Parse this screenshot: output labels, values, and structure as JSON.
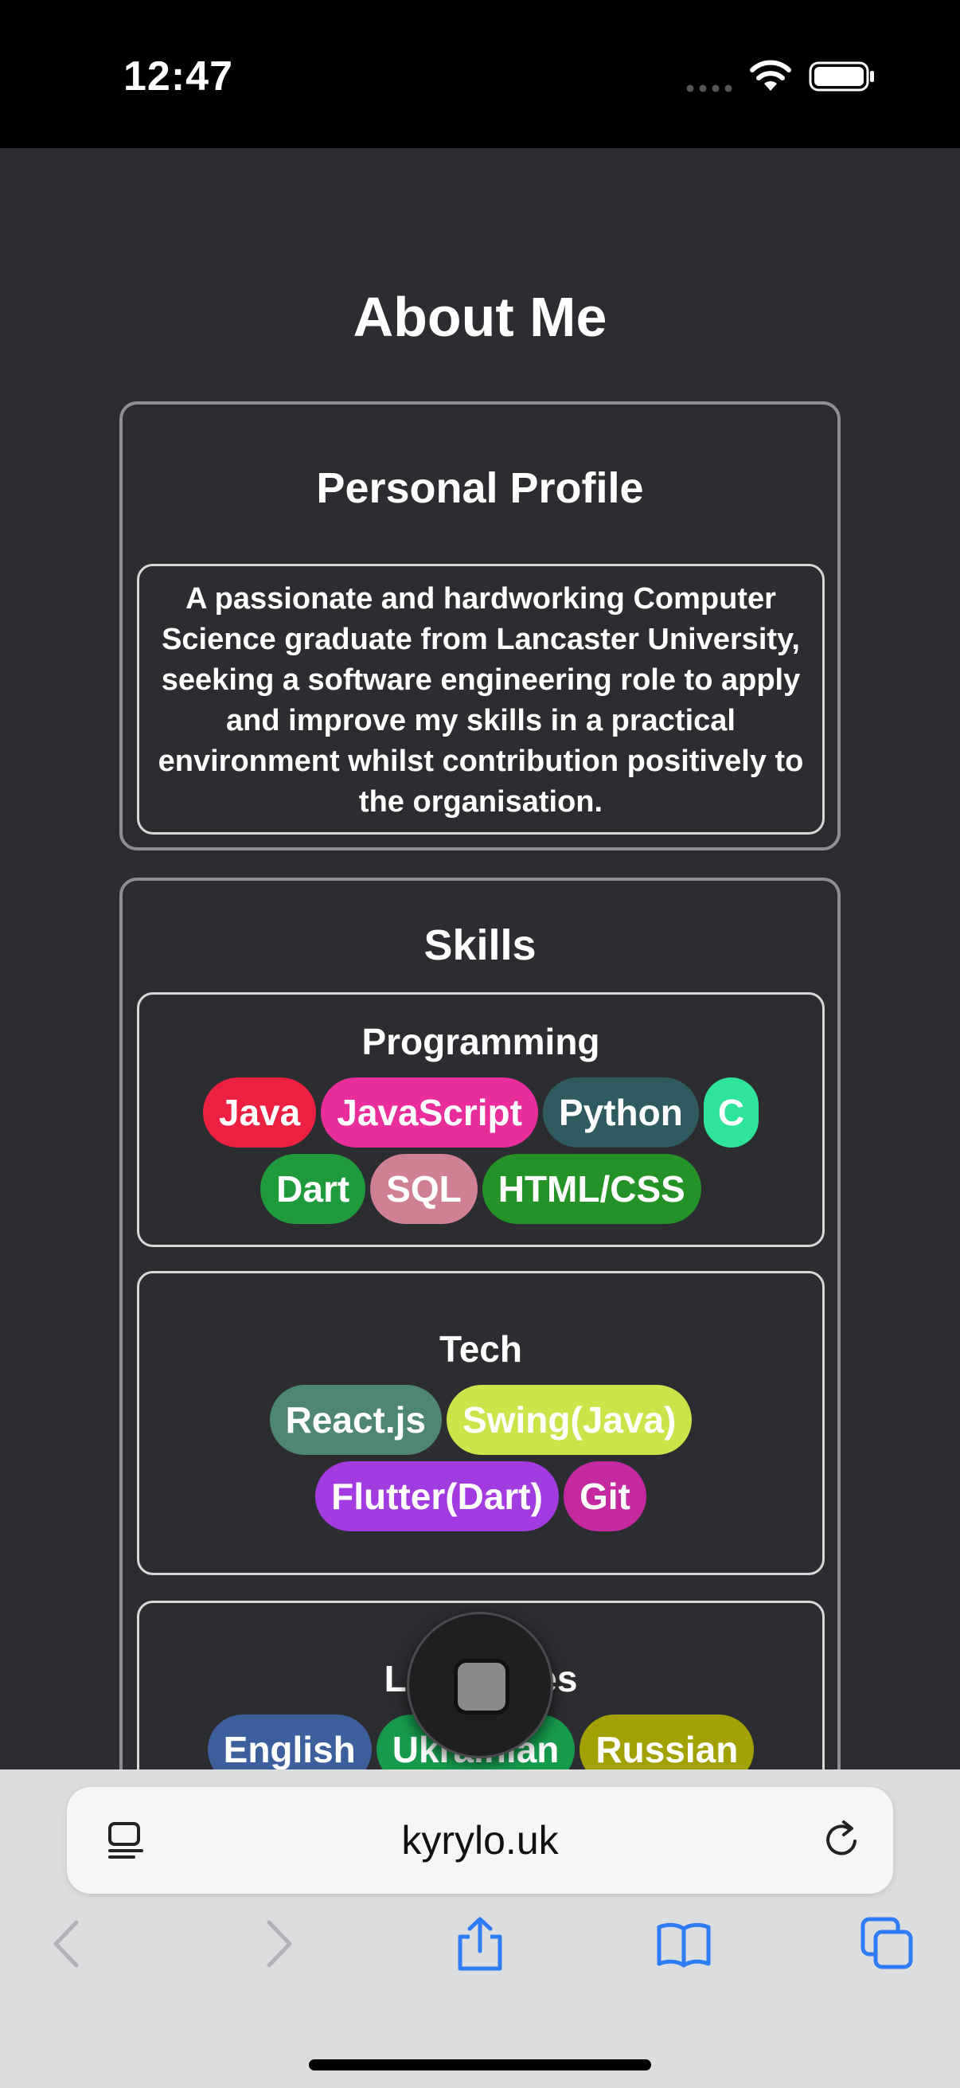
{
  "status_bar": {
    "time": "12:47"
  },
  "page": {
    "title": "About Me",
    "profile": {
      "title": "Personal Profile",
      "text": "A passionate and hardworking Computer Science graduate from Lancaster University, seeking a software engineering role to apply and improve my skills in a practical environment whilst contribution positively to the organisation."
    },
    "skills": {
      "title": "Skills",
      "programming": {
        "title": "Programming",
        "tags": [
          {
            "label": "Java",
            "color": "#ec2040"
          },
          {
            "label": "JavaScript",
            "color": "#e92e9c"
          },
          {
            "label": "Python",
            "color": "#2f5b60"
          },
          {
            "label": "C",
            "color": "#2ee39a"
          },
          {
            "label": "Dart",
            "color": "#1f9a3c"
          },
          {
            "label": "SQL",
            "color": "#cf8193"
          },
          {
            "label": "HTML/CSS",
            "color": "#259228"
          }
        ]
      },
      "tech": {
        "title": "Tech",
        "tags": [
          {
            "label": "React.js",
            "color": "#4e8672"
          },
          {
            "label": "Swing(Java)",
            "color": "#cbe44a"
          },
          {
            "label": "Flutter(Dart)",
            "color": "#a23be0"
          },
          {
            "label": "Git",
            "color": "#c429a0"
          }
        ]
      },
      "languages": {
        "title": "Languages",
        "tags": [
          {
            "label": "English",
            "color": "#3d5f9c"
          },
          {
            "label": "Ukrainian",
            "color": "#169a4c"
          },
          {
            "label": "Russian",
            "color": "#a3a102"
          }
        ]
      }
    }
  },
  "browser": {
    "url": "kyrylo.uk",
    "icons": [
      "reader-icon",
      "reload-icon",
      "back-icon",
      "forward-icon",
      "share-icon",
      "bookmarks-icon",
      "tabs-icon"
    ]
  }
}
